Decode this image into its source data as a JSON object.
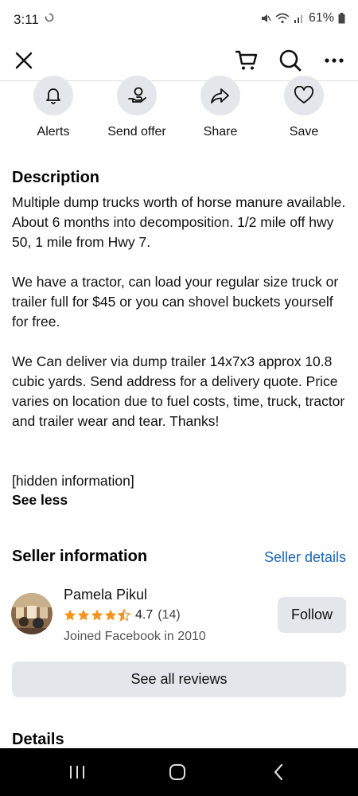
{
  "status_bar": {
    "time": "3:11",
    "battery": "61%"
  },
  "top_bar": {
    "close_icon": "close-icon",
    "cart_icon": "cart-icon",
    "search_icon": "search-icon",
    "more_icon": "more-icon"
  },
  "actions": [
    {
      "label": "Alerts",
      "icon": "bell-icon"
    },
    {
      "label": "Send offer",
      "icon": "offer-icon"
    },
    {
      "label": "Share",
      "icon": "share-icon"
    },
    {
      "label": "Save",
      "icon": "heart-icon"
    }
  ],
  "description": {
    "title": "Description",
    "paragraphs": [
      "Multiple dump trucks worth of horse manure available. About 6 months into decomposition. 1/2 mile off hwy 50, 1 mile from Hwy 7.",
      "We have a tractor, can load your regular size truck or trailer full for $45 or you can shovel buckets yourself for free.",
      "We Can deliver via dump trailer 14x7x3 approx 10.8 cubic yards. Send address for a delivery quote. Price varies on location due to fuel costs, time, truck, tractor and trailer wear and tear. Thanks!",
      "[hidden information]"
    ],
    "see_less": "See less"
  },
  "seller": {
    "section_title": "Seller information",
    "details_link": "Seller details",
    "name": "Pamela Pikul",
    "rating": "4.7",
    "rating_count": "(14)",
    "stars": 4.5,
    "joined": "Joined Facebook in 2010",
    "follow_label": "Follow",
    "reviews_label": "See all reviews"
  },
  "details": {
    "title": "Details"
  },
  "colors": {
    "accent": "#1b64b8",
    "star": "#f7931e",
    "button_bg": "#e4e6eb"
  }
}
